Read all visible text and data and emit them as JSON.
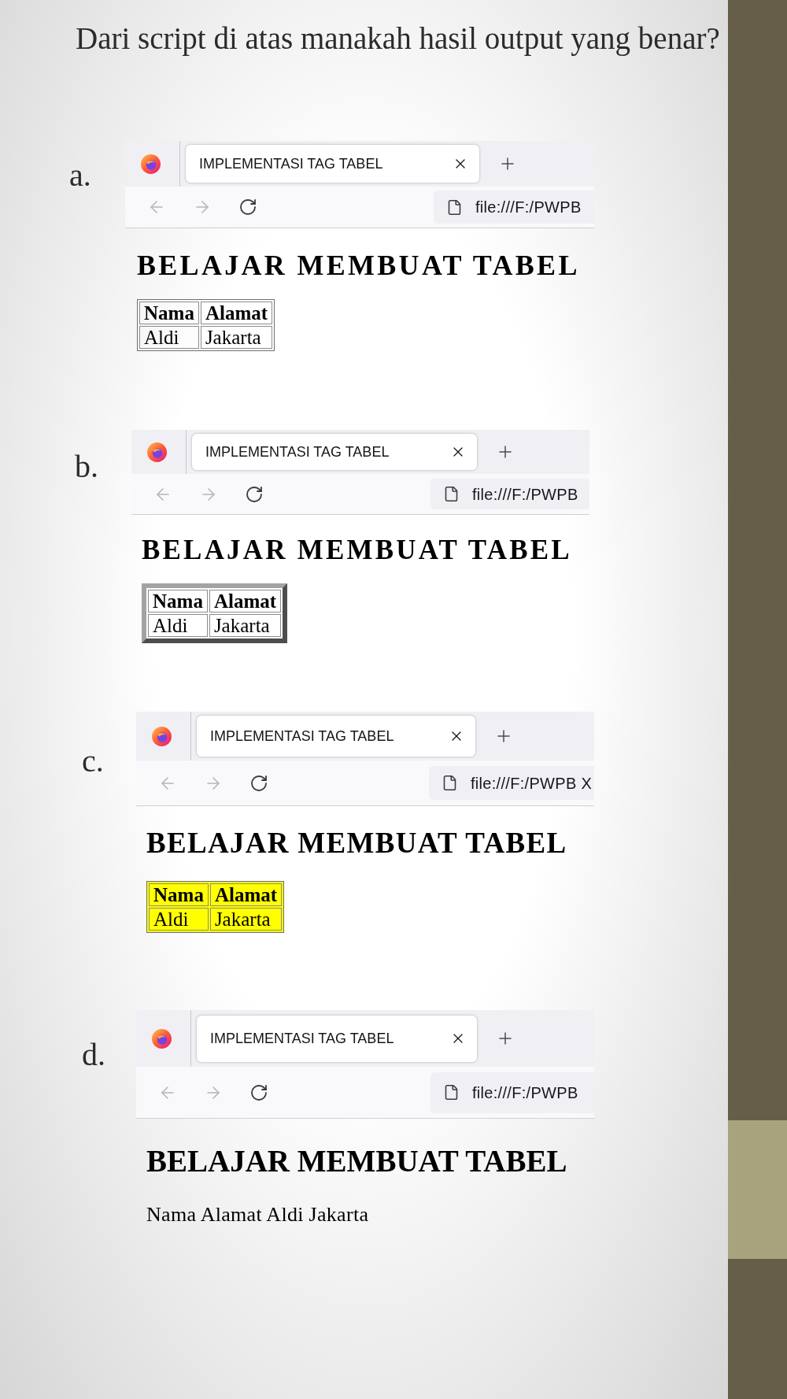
{
  "question": "Dari script di atas manakah hasil output yang benar?",
  "options": [
    {
      "label": "a.",
      "browser": {
        "tab_title": "IMPLEMENTASI TAG TABEL",
        "back": {
          "disabled": true
        },
        "forward": {
          "disabled": true
        },
        "url": "file:///F:/PWPB"
      },
      "page": {
        "heading": "BELAJAR MEMBUAT TABEL",
        "output": {
          "kind": "table",
          "raised": false,
          "header": [
            "Nama",
            "Alamat"
          ],
          "rows": [
            [
              "Aldi",
              "Jakarta"
            ]
          ]
        }
      }
    },
    {
      "label": "b.",
      "browser": {
        "tab_title": "IMPLEMENTASI TAG TABEL",
        "back": {
          "disabled": true
        },
        "forward": {
          "disabled": true
        },
        "url": "file:///F:/PWPB"
      },
      "page": {
        "heading": "BELAJAR MEMBUAT TABEL",
        "output": {
          "kind": "table",
          "raised": true,
          "header": [
            "Nama",
            "Alamat"
          ],
          "rows": [
            [
              "Aldi",
              "Jakarta"
            ]
          ]
        }
      }
    },
    {
      "label": "c.",
      "browser": {
        "tab_title": "IMPLEMENTASI TAG TABEL",
        "back": {
          "disabled": true
        },
        "forward": {
          "disabled": true
        },
        "url": "file:///F:/PWPB X"
      },
      "page": {
        "heading": "BELAJAR MEMBUAT TABEL",
        "output": {
          "kind": "table",
          "raised": false,
          "color": "#ffff00",
          "header": [
            "Nama",
            "Alamat"
          ],
          "rows": [
            [
              "Aldi",
              "Jakarta"
            ]
          ]
        }
      }
    },
    {
      "label": "d.",
      "browser": {
        "tab_title": "IMPLEMENTASI TAG TABEL",
        "back": {
          "disabled": true
        },
        "forward": {
          "disabled": true
        },
        "url": "file:///F:/PWPB"
      },
      "page": {
        "heading": "BELAJAR MEMBUAT TABEL",
        "output": {
          "kind": "text",
          "text": "Nama Alamat Aldi Jakarta"
        }
      }
    }
  ]
}
